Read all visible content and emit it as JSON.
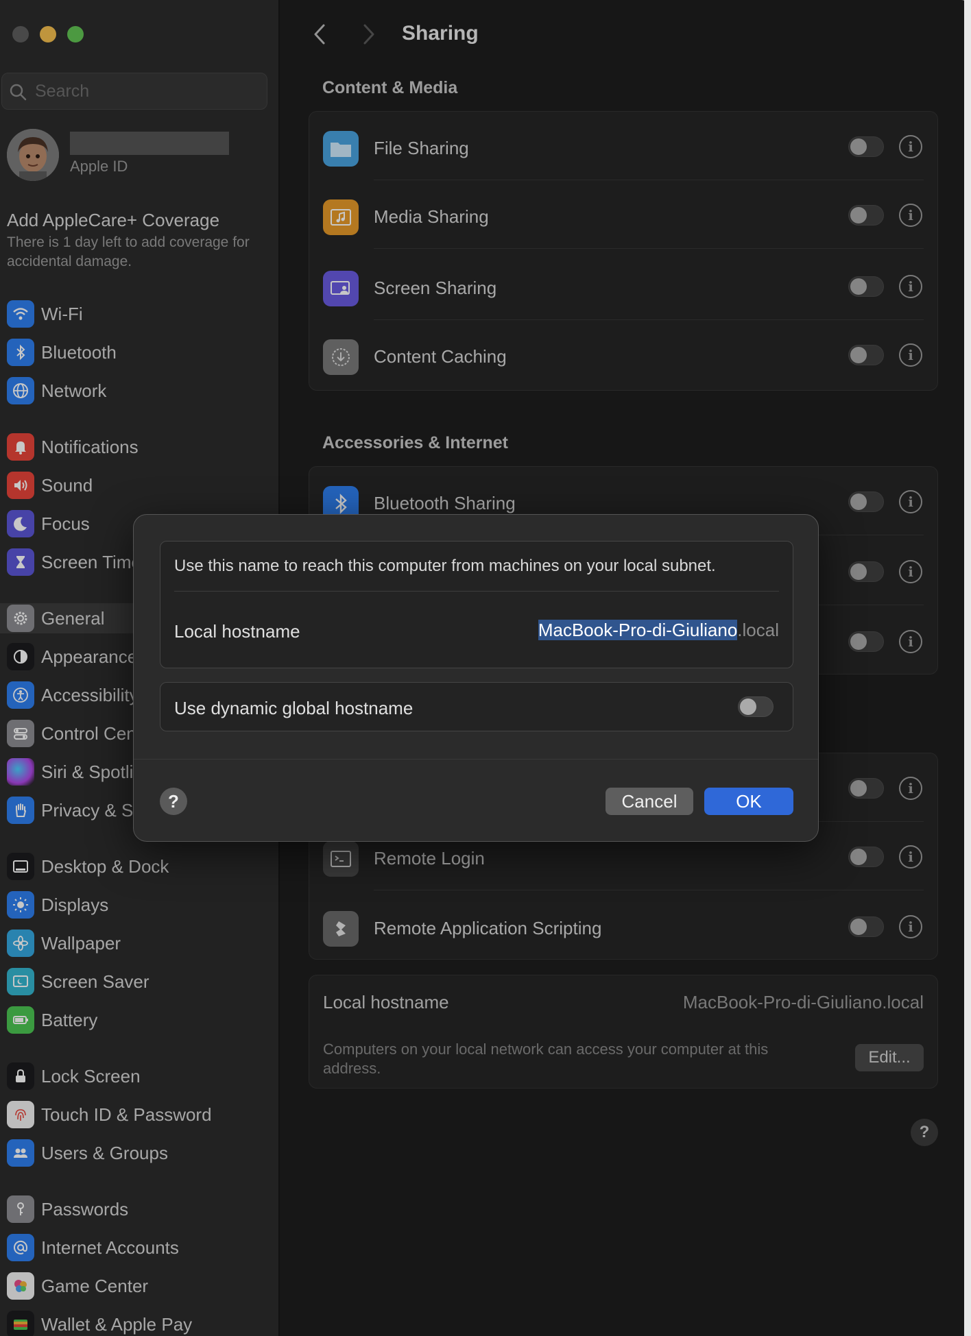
{
  "window": {
    "title": "Sharing"
  },
  "sidebar": {
    "search_placeholder": "Search",
    "apple_id_label": "Apple ID",
    "applecare": {
      "title": "Add AppleCare+ Coverage",
      "body": "There is 1 day left to add coverage for accidental damage."
    },
    "items": [
      {
        "label": "Wi-Fi",
        "icon": "wifi-icon",
        "color": "#2f7ff0"
      },
      {
        "label": "Bluetooth",
        "icon": "bluetooth-icon",
        "color": "#2f7ff0"
      },
      {
        "label": "Network",
        "icon": "globe-icon",
        "color": "#2f7ff0"
      },
      {
        "label": "Notifications",
        "icon": "bell-icon",
        "color": "#e8443a"
      },
      {
        "label": "Sound",
        "icon": "speaker-icon",
        "color": "#e8443a"
      },
      {
        "label": "Focus",
        "icon": "moon-icon",
        "color": "#5c56d6"
      },
      {
        "label": "Screen Time",
        "icon": "hourglass-icon",
        "color": "#5c56d6"
      },
      {
        "label": "General",
        "icon": "gear-icon",
        "color": "#8e8e93"
      },
      {
        "label": "Appearance",
        "icon": "appearance-icon",
        "color": "#1c1c1e"
      },
      {
        "label": "Accessibility",
        "icon": "accessibility-icon",
        "color": "#2f7ff0"
      },
      {
        "label": "Control Centre",
        "icon": "control-centre-icon",
        "color": "#8e8e93"
      },
      {
        "label": "Siri & Spotlight",
        "icon": "siri-icon",
        "color": "#b048e8"
      },
      {
        "label": "Privacy & Security",
        "icon": "hand-icon",
        "color": "#2f7ff0"
      },
      {
        "label": "Desktop & Dock",
        "icon": "dock-icon",
        "color": "#1c1c1e"
      },
      {
        "label": "Displays",
        "icon": "sun-icon",
        "color": "#2f7ff0"
      },
      {
        "label": "Wallpaper",
        "icon": "flower-icon",
        "color": "#35a8e0"
      },
      {
        "label": "Screen Saver",
        "icon": "screen-saver-icon",
        "color": "#35b6d0"
      },
      {
        "label": "Battery",
        "icon": "battery-icon",
        "color": "#4cc652"
      },
      {
        "label": "Lock Screen",
        "icon": "lock-icon",
        "color": "#1c1c1e"
      },
      {
        "label": "Touch ID & Password",
        "icon": "fingerprint-icon",
        "color": "#f2f2f2"
      },
      {
        "label": "Users & Groups",
        "icon": "users-icon",
        "color": "#2f7ff0"
      },
      {
        "label": "Passwords",
        "icon": "key-icon",
        "color": "#8e8e93"
      },
      {
        "label": "Internet Accounts",
        "icon": "at-icon",
        "color": "#2f7ff0"
      },
      {
        "label": "Game Center",
        "icon": "game-center-icon",
        "color": "#f2f2f2"
      },
      {
        "label": "Wallet & Apple Pay",
        "icon": "wallet-icon",
        "color": "#1c1c1e"
      }
    ]
  },
  "sections": {
    "content_media": {
      "title": "Content & Media",
      "rows": [
        {
          "label": "File Sharing",
          "icon": "folder-icon",
          "color": "#4aa3df",
          "enabled": false
        },
        {
          "label": "Media Sharing",
          "icon": "media-icon",
          "color": "#e79a2a",
          "enabled": false
        },
        {
          "label": "Screen Sharing",
          "icon": "screen-sharing-icon",
          "color": "#6a5ce0",
          "enabled": false
        },
        {
          "label": "Content Caching",
          "icon": "caching-icon",
          "color": "#8e8e93",
          "enabled": false
        }
      ]
    },
    "accessories_internet": {
      "title": "Accessories & Internet",
      "rows": [
        {
          "label": "Bluetooth Sharing",
          "icon": "bluetooth-icon",
          "color": "#2f7ff0",
          "enabled": false
        }
      ]
    },
    "advanced": {
      "rows": [
        {
          "label": "Remote Login",
          "icon": "terminal-icon",
          "color": "#4a4a4a",
          "enabled": false
        },
        {
          "label": "Remote Application Scripting",
          "icon": "script-icon",
          "color": "#6a6a6a",
          "enabled": false
        }
      ]
    }
  },
  "local_hostname": {
    "label": "Local hostname",
    "value": "MacBook-Pro-di-Giuliano.local",
    "description": "Computers on your local network can access your computer at this address.",
    "edit_label": "Edit..."
  },
  "dialog": {
    "description": "Use this name to reach this computer from machines on your local subnet.",
    "hostname_label": "Local hostname",
    "hostname_value": "MacBook-Pro-di-Giuliano",
    "hostname_suffix": ".local",
    "dynamic_label": "Use dynamic global hostname",
    "dynamic_enabled": false,
    "cancel_label": "Cancel",
    "ok_label": "OK",
    "help_label": "?"
  },
  "help_label": "?",
  "info_glyph": "i"
}
